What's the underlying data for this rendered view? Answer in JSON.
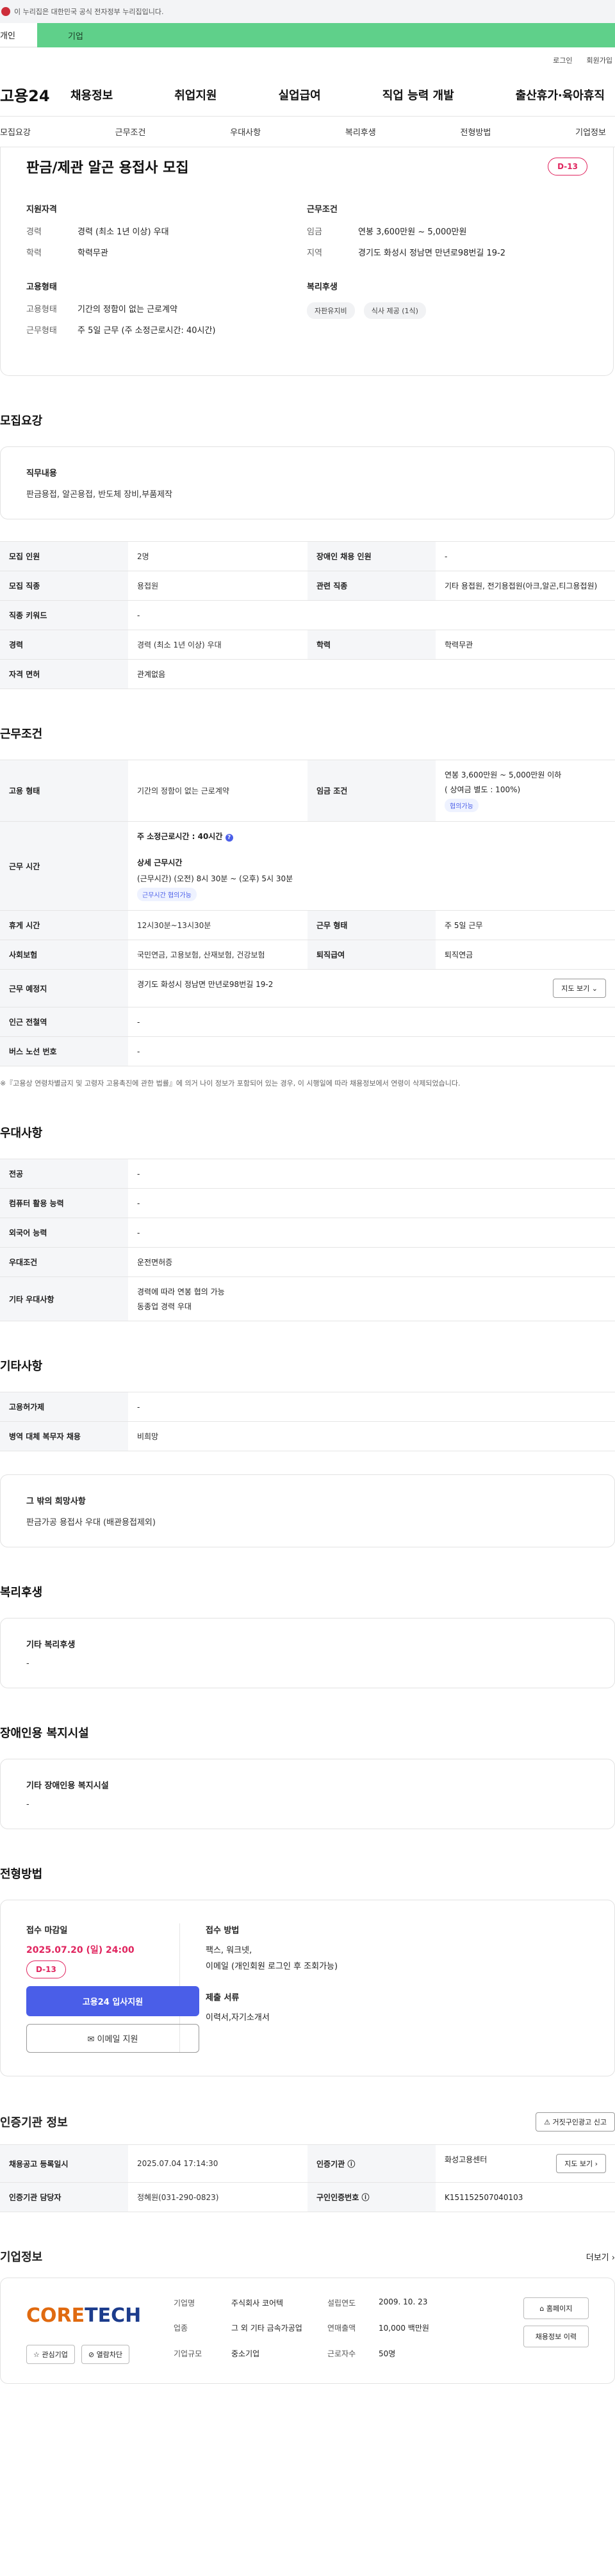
{
  "gov": {
    "text": "이 누리집은 대한민국 공식 전자정부 누리집입니다."
  },
  "user_tabs": {
    "individual": "개인",
    "company": "기업"
  },
  "util": {
    "login": "로그인",
    "signup": "회원가입"
  },
  "gnb": {
    "logo": "고용24",
    "menu": [
      "채용정보",
      "취업지원",
      "실업급여",
      "직업 능력 개발",
      "출산휴가·육아휴직"
    ]
  },
  "subnav": [
    "모집요강",
    "근무조건",
    "우대사항",
    "복리후생",
    "전형방법",
    "기업정보"
  ],
  "summary": {
    "title": "판금/제관 알곤 용접사 모집",
    "dday": "D-13",
    "qual_title": "지원자격",
    "career_k": "경력",
    "career_v": "경력 (최소 1년 이상) 우대",
    "edu_k": "학력",
    "edu_v": "학력무관",
    "emp_title": "고용형태",
    "emptype_k": "고용형태",
    "emptype_v": "기간의 정함이 없는 근로계약",
    "worktype_k": "근무형태",
    "worktype_v": "주 5일 근무 (주 소정근로시간: 40시간)",
    "cond_title": "근무조건",
    "wage_k": "임금",
    "wage_v": "연봉 3,600만원 ~ 5,000만원",
    "region_k": "지역",
    "region_v": "경기도 화성시 정남면 만년로98번길 19-2",
    "welfare_title": "복리후생",
    "chips": [
      "자판유지비",
      "식사 제공 (1식)"
    ]
  },
  "recruit": {
    "title": "모집요강",
    "job_title": "직무내용",
    "job_v": "판금용접, 알곤용접, 반도체 장비,부품제작",
    "rows": [
      {
        "k1": "모집 인원",
        "v1": "2명",
        "k2": "장애인 채용 인원",
        "v2": "-"
      },
      {
        "k1": "모집 직종",
        "v1": "용접원",
        "k2": "관련 직종",
        "v2": "기타 용접원, 전기용접원(아크,알곤,티그용접원)"
      },
      {
        "k1": "직종 키워드",
        "v1": "-",
        "k2": "",
        "v2": ""
      },
      {
        "k1": "경력",
        "v1": "경력 (최소 1년 이상) 우대",
        "k2": "학력",
        "v2": "학력무관"
      },
      {
        "k1": "자격 면허",
        "v1": "관계없음",
        "k2": "",
        "v2": ""
      }
    ]
  },
  "work": {
    "title": "근무조건",
    "emp_k": "고용 형태",
    "emp_v": "기간의 정함이 없는 근로계약",
    "wage_k": "임금 조건",
    "wage_v": "연봉 3,600만원 ~ 5,000만원 이하",
    "wage_sub": "( 상여금 별도 : 100%)",
    "wage_tag": "협의가능",
    "time_k": "근무 시간",
    "time_main": "주 소정근로시간 : 40시간",
    "time_detail_title": "상세 근무시간",
    "time_detail": "(근무시간) (오전) 8시 30분 ~ (오후) 5시 30분",
    "time_tag": "근무시간 협의가능",
    "rest_k": "휴게 시간",
    "rest_v": "12시30분~13시30분",
    "shift_k": "근무 형태",
    "shift_v": "주 5일 근무",
    "ins_k": "사회보험",
    "ins_v": "국민연금, 고용보험, 산재보험, 건강보험",
    "ret_k": "퇴직급여",
    "ret_v": "퇴직연금",
    "place_k": "근무 예정지",
    "place_v": "경기도 화성시 정남면 만년로98번길 19-2",
    "map": "지도 보기",
    "subway_k": "인근 전철역",
    "subway_v": "-",
    "bus_k": "버스 노선 번호",
    "bus_v": "-",
    "note": "※『고용상 연령차별금지 및 고령자 고용촉진에 관한 법률』에 의거 나이 정보가 포함되어 있는 경우, 이 시행일에 따라 채용정보에서 연령이 삭제되었습니다."
  },
  "pref": {
    "title": "우대사항",
    "rows": [
      {
        "k": "전공",
        "v": "-"
      },
      {
        "k": "컴퓨터 활용 능력",
        "v": "-"
      },
      {
        "k": "외국어 능력",
        "v": "-"
      },
      {
        "k": "우대조건",
        "v": "운전면허증"
      },
      {
        "k": "기타 우대사항",
        "v": "경력에 따라 연봉 협의 가능",
        "v2": "동종업 경력 우대"
      }
    ]
  },
  "etc": {
    "title": "기타사항",
    "rows": [
      {
        "k": "고용허가제",
        "v": "-"
      },
      {
        "k": "병역 대체 복무자 채용",
        "v": "비희망"
      }
    ],
    "other_title": "그 밖의 희망사항",
    "other_v": "판금가공 용접사 우대 (배관용접제외)"
  },
  "welfare": {
    "title": "복리후생",
    "box_title": "기타 복리후생",
    "box_v": "-"
  },
  "disab": {
    "title": "장애인용 복지시설",
    "box_title": "기타 장애인용 복지시설",
    "box_v": "-"
  },
  "apply": {
    "title": "전형방법",
    "deadline_label": "접수 마감일",
    "deadline": "2025.07.20 (일) 24:00",
    "dday": "D-13",
    "apply_btn": "고용24 입사지원",
    "email_btn": "이메일 지원",
    "method_label": "접수 방법",
    "method_v": "팩스, 워크넷,",
    "method_v2": "이메일 (개인회원 로그인 후 조회가능)",
    "docs_label": "제출 서류",
    "docs_v": "이력서,자기소개서"
  },
  "cert": {
    "title": "인증기관 정보",
    "report": "거짓구인광고 신고",
    "rows": [
      {
        "k1": "채용공고 등록일시",
        "v1": "2025.07.04 17:14:30",
        "k2": "인증기관",
        "v2": "화성고용센터",
        "btn": "지도 보기"
      },
      {
        "k1": "인증기관 담당자",
        "v1": "정혜원(031-290-0823)",
        "k2": "구인인증번호",
        "v2": "K151152507040103",
        "btn": ""
      }
    ]
  },
  "company": {
    "title": "기업정보",
    "more": "더보기",
    "logo_a": "CORE",
    "logo_b": "TECH",
    "fav": "관심기업",
    "block": "열람차단",
    "info": [
      {
        "k": "기업명",
        "v": "주식회사 코어텍"
      },
      {
        "k": "설립연도",
        "v": "2009. 10. 23"
      },
      {
        "k": "업종",
        "v": "그 외 기타 금속가공업"
      },
      {
        "k": "연매출액",
        "v": "10,000 백만원"
      },
      {
        "k": "기업규모",
        "v": "중소기업"
      },
      {
        "k": "근로자수",
        "v": "50명"
      }
    ],
    "homepage": "홈페이지",
    "history": "채용정보 이력"
  }
}
